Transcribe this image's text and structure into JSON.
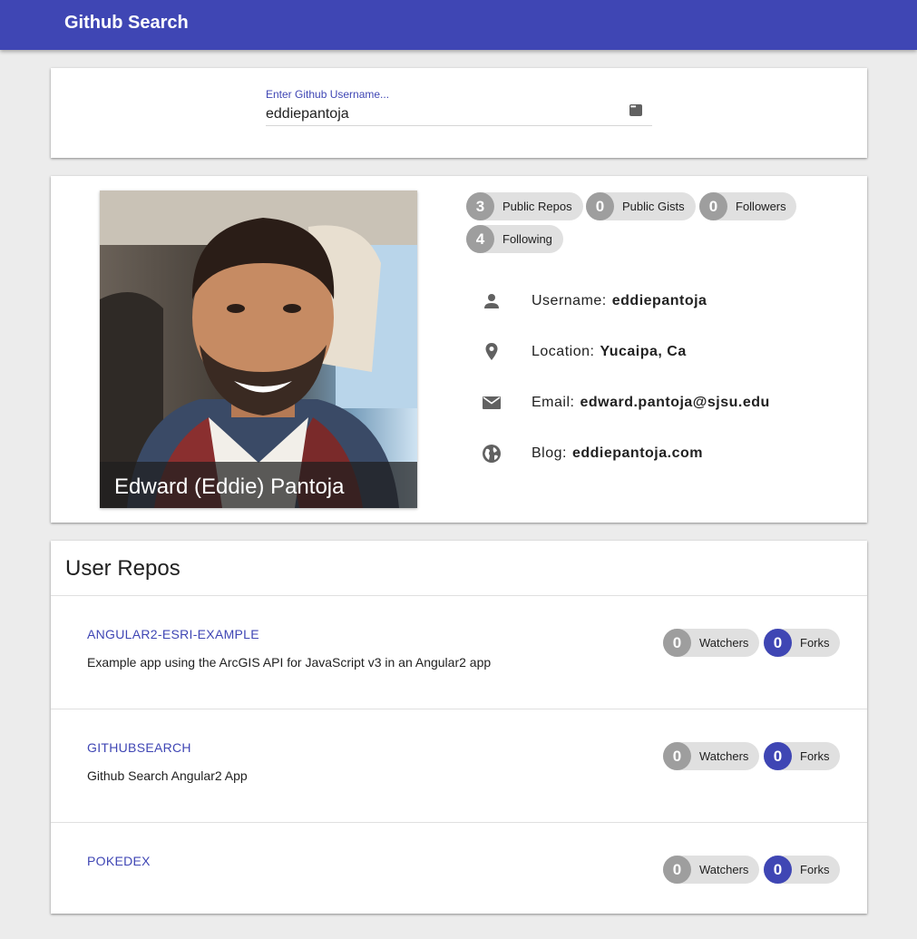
{
  "toolbar": {
    "title": "Github Search"
  },
  "search": {
    "label": "Enter Github Username...",
    "value": "eddiepantoja",
    "more_icon": "more-horiz-icon"
  },
  "profile": {
    "name": "Edward (Eddie) Pantoja",
    "stats": [
      {
        "count": "3",
        "label": "Public Repos"
      },
      {
        "count": "0",
        "label": "Public Gists"
      },
      {
        "count": "0",
        "label": "Followers"
      },
      {
        "count": "4",
        "label": "Following"
      }
    ],
    "info": [
      {
        "icon": "person-icon",
        "label": "Username:",
        "value": "eddiepantoja"
      },
      {
        "icon": "location-pin-icon",
        "label": "Location:",
        "value": "Yucaipa, Ca"
      },
      {
        "icon": "email-icon",
        "label": "Email:",
        "value": "edward.pantoja@sjsu.edu"
      },
      {
        "icon": "globe-icon",
        "label": "Blog:",
        "value": "eddiepantoja.com"
      }
    ]
  },
  "repos": {
    "title": "User Repos",
    "watchers_label": "Watchers",
    "forks_label": "Forks",
    "items": [
      {
        "name": "ANGULAR2-ESRI-EXAMPLE",
        "description": "Example app using the ArcGIS API for JavaScript v3 in an Angular2 app",
        "watchers": "0",
        "forks": "0"
      },
      {
        "name": "GITHUBSEARCH",
        "description": "Github Search Angular2 App",
        "watchers": "0",
        "forks": "0"
      },
      {
        "name": "POKEDEX",
        "description": "",
        "watchers": "0",
        "forks": "0"
      }
    ]
  },
  "colors": {
    "primary": "#3f46b4",
    "chip_gray": "#9e9e9e",
    "chip_bg": "#e0e0e0"
  }
}
